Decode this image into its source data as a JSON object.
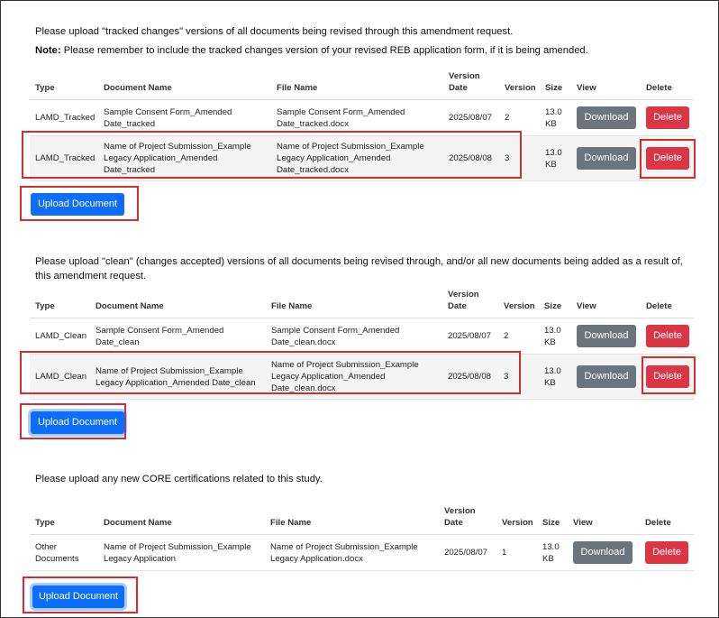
{
  "colors": {
    "highlight": "#d32f2f",
    "primary": "#0d6efd",
    "danger": "#dc3545",
    "secondary": "#6c757d"
  },
  "columns": [
    "Type",
    "Document Name",
    "File Name",
    "Version Date",
    "Version",
    "Size",
    "View",
    "Delete"
  ],
  "columns_wrapped": {
    "version_date_1": "Version",
    "version_date_2": "Date"
  },
  "buttons": {
    "download": "Download",
    "delete": "Delete",
    "upload": "Upload Document"
  },
  "section1": {
    "intro": "Please upload \"tracked changes\" versions of all documents being revised through this amendment request.",
    "note_label": "Note:",
    "note_text": " Please remember to include the tracked changes version of your revised REB application form, if it is being amended.",
    "rows": [
      {
        "type": "LAMD_Tracked",
        "doc_name_1": "Sample Consent Form_Amended",
        "doc_name_2": "Date_tracked",
        "file_1": "Sample Consent Form_Amended",
        "file_2": "Date_tracked.docx",
        "file_3": "",
        "date": "2025/08/07",
        "version": "2",
        "size_1": "13.0",
        "size_2": "KB"
      },
      {
        "type": "LAMD_Tracked",
        "doc_name_1": "Name of Project Submission_Example",
        "doc_name_2": "Legacy Application_Amended Date_tracked",
        "file_1": "Name of Project Submission_Example",
        "file_2": "Legacy Application_Amended",
        "file_3": "Date_tracked.docx",
        "date": "2025/08/08",
        "version": "3",
        "size_1": "13.0",
        "size_2": "KB"
      }
    ]
  },
  "section2": {
    "intro": "Please upload \"clean\" (changes accepted) versions of all documents being revised through, and/or all new documents being added as a result of, this amendment request.",
    "rows": [
      {
        "type": "LAMD_Clean",
        "doc_name_1": "Sample Consent Form_Amended",
        "doc_name_2": "Date_clean",
        "file_1": "Sample Consent Form_Amended",
        "file_2": "Date_clean.docx",
        "file_3": "",
        "date": "2025/08/07",
        "version": "2",
        "size_1": "13.0",
        "size_2": "KB"
      },
      {
        "type": "LAMD_Clean",
        "doc_name_1": "Name of Project Submission_Example",
        "doc_name_2": "Legacy Application_Amended Date_clean",
        "file_1": "Name of Project Submission_Example",
        "file_2": "Legacy Application_Amended",
        "file_3": "Date_clean.docx",
        "date": "2025/08/08",
        "version": "3",
        "size_1": "13.0",
        "size_2": "KB"
      }
    ]
  },
  "section3": {
    "intro": "Please upload any new CORE certifications related to this study.",
    "rows": [
      {
        "type_1": "Other",
        "type_2": "Documents",
        "doc_name_1": "Name of Project Submission_Example",
        "doc_name_2": "Legacy Application",
        "file_1": "Name of Project Submission_Example",
        "file_2": "Legacy Application.docx",
        "date": "2025/08/07",
        "version": "1",
        "size_1": "13.0",
        "size_2": "KB"
      }
    ]
  }
}
